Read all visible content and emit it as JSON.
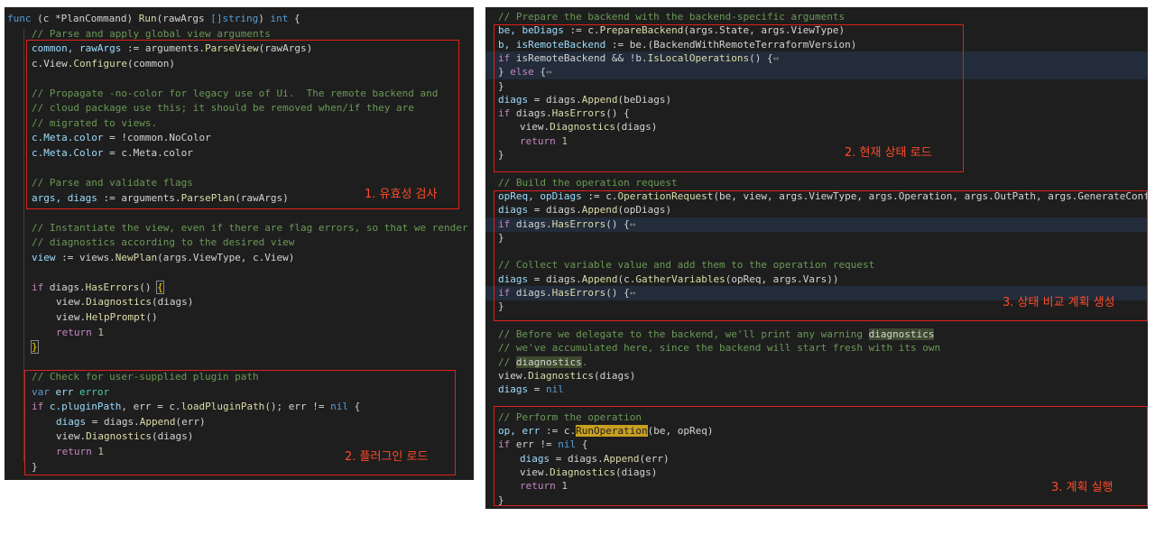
{
  "left_panel": {
    "lines": [
      {
        "hl": false,
        "indent": 0,
        "tokens": [
          {
            "t": "func",
            "c": "keyword"
          },
          {
            "t": " (c ",
            "c": "plain"
          },
          {
            "t": "*PlanCommand",
            "c": "plain"
          },
          {
            "t": ") ",
            "c": "plain"
          },
          {
            "t": "Run",
            "c": "func"
          },
          {
            "t": "(rawArgs ",
            "c": "plain"
          },
          {
            "t": "[]string",
            "c": "keyword"
          },
          {
            "t": ") ",
            "c": "plain"
          },
          {
            "t": "int",
            "c": "keyword"
          },
          {
            "t": " {",
            "c": "plain"
          }
        ]
      },
      {
        "hl": false,
        "indent": 1,
        "tokens": [
          {
            "t": "// Parse and apply global view arguments",
            "c": "comment"
          }
        ]
      },
      {
        "hl": false,
        "indent": 1,
        "tokens": [
          {
            "t": "common, rawArgs",
            "c": "var"
          },
          {
            "t": " := arguments.",
            "c": "plain"
          },
          {
            "t": "ParseView",
            "c": "func"
          },
          {
            "t": "(rawArgs)",
            "c": "plain"
          }
        ]
      },
      {
        "hl": false,
        "indent": 1,
        "tokens": [
          {
            "t": "c.View.",
            "c": "plain"
          },
          {
            "t": "Configure",
            "c": "func"
          },
          {
            "t": "(common)",
            "c": "plain"
          }
        ]
      },
      {
        "hl": false,
        "indent": 1,
        "tokens": []
      },
      {
        "hl": false,
        "indent": 1,
        "tokens": [
          {
            "t": "// Propagate -no-color for legacy use of Ui.  The remote backend and",
            "c": "comment"
          }
        ]
      },
      {
        "hl": false,
        "indent": 1,
        "tokens": [
          {
            "t": "// cloud package use this; it should be removed when/if they are",
            "c": "comment"
          }
        ]
      },
      {
        "hl": false,
        "indent": 1,
        "tokens": [
          {
            "t": "// migrated to views.",
            "c": "comment"
          }
        ]
      },
      {
        "hl": false,
        "indent": 1,
        "tokens": [
          {
            "t": "c.Meta.color",
            "c": "var"
          },
          {
            "t": " = !common.NoColor",
            "c": "plain"
          }
        ]
      },
      {
        "hl": false,
        "indent": 1,
        "tokens": [
          {
            "t": "c.Meta.Color",
            "c": "var"
          },
          {
            "t": " = c.Meta.color",
            "c": "plain"
          }
        ]
      },
      {
        "hl": false,
        "indent": 1,
        "tokens": []
      },
      {
        "hl": false,
        "indent": 1,
        "tokens": [
          {
            "t": "// Parse and validate flags",
            "c": "comment"
          }
        ]
      },
      {
        "hl": false,
        "indent": 1,
        "tokens": [
          {
            "t": "args, diags",
            "c": "var"
          },
          {
            "t": " := arguments.",
            "c": "plain"
          },
          {
            "t": "ParsePlan",
            "c": "func"
          },
          {
            "t": "(rawArgs)",
            "c": "plain"
          }
        ]
      },
      {
        "hl": false,
        "indent": 1,
        "tokens": []
      },
      {
        "hl": false,
        "indent": 1,
        "tokens": [
          {
            "t": "// Instantiate the view, even if there are flag errors, so that we render",
            "c": "comment"
          }
        ]
      },
      {
        "hl": false,
        "indent": 1,
        "tokens": [
          {
            "t": "// diagnostics according to the desired view",
            "c": "comment"
          }
        ]
      },
      {
        "hl": false,
        "indent": 1,
        "tokens": [
          {
            "t": "view",
            "c": "var"
          },
          {
            "t": " := views.",
            "c": "plain"
          },
          {
            "t": "NewPlan",
            "c": "func"
          },
          {
            "t": "(args.ViewType, c.View)",
            "c": "plain"
          }
        ]
      },
      {
        "hl": false,
        "indent": 1,
        "tokens": []
      },
      {
        "hl": false,
        "indent": 1,
        "tokens": [
          {
            "t": "if",
            "c": "control"
          },
          {
            "t": " diags.",
            "c": "plain"
          },
          {
            "t": "HasErrors",
            "c": "func"
          },
          {
            "t": "() ",
            "c": "plain"
          },
          {
            "t": "{",
            "c": "brace"
          }
        ]
      },
      {
        "hl": false,
        "indent": 2,
        "tokens": [
          {
            "t": "view.",
            "c": "plain"
          },
          {
            "t": "Diagnostics",
            "c": "func"
          },
          {
            "t": "(diags)",
            "c": "plain"
          }
        ]
      },
      {
        "hl": false,
        "indent": 2,
        "tokens": [
          {
            "t": "view.",
            "c": "plain"
          },
          {
            "t": "HelpPrompt",
            "c": "func"
          },
          {
            "t": "()",
            "c": "plain"
          }
        ]
      },
      {
        "hl": false,
        "indent": 2,
        "tokens": [
          {
            "t": "return",
            "c": "control"
          },
          {
            "t": " ",
            "c": "plain"
          },
          {
            "t": "1",
            "c": "num"
          }
        ]
      },
      {
        "hl": false,
        "indent": 1,
        "tokens": [
          {
            "t": "}",
            "c": "brace"
          }
        ]
      },
      {
        "hl": false,
        "indent": 1,
        "tokens": []
      },
      {
        "hl": false,
        "indent": 1,
        "tokens": [
          {
            "t": "// Check for user-supplied plugin path",
            "c": "comment"
          }
        ]
      },
      {
        "hl": false,
        "indent": 1,
        "tokens": [
          {
            "t": "var",
            "c": "keyword"
          },
          {
            "t": " err ",
            "c": "var"
          },
          {
            "t": "error",
            "c": "type"
          }
        ]
      },
      {
        "hl": false,
        "indent": 1,
        "tokens": [
          {
            "t": "if",
            "c": "control"
          },
          {
            "t": " ",
            "c": "plain"
          },
          {
            "t": "c.pluginPath",
            "c": "var"
          },
          {
            "t": ", err = c.",
            "c": "plain"
          },
          {
            "t": "loadPluginPath",
            "c": "func"
          },
          {
            "t": "(); err != ",
            "c": "plain"
          },
          {
            "t": "nil",
            "c": "keyword"
          },
          {
            "t": " {",
            "c": "plain"
          }
        ]
      },
      {
        "hl": false,
        "indent": 2,
        "tokens": [
          {
            "t": "diags",
            "c": "var"
          },
          {
            "t": " = diags.",
            "c": "plain"
          },
          {
            "t": "Append",
            "c": "func"
          },
          {
            "t": "(err)",
            "c": "plain"
          }
        ]
      },
      {
        "hl": false,
        "indent": 2,
        "tokens": [
          {
            "t": "view.",
            "c": "plain"
          },
          {
            "t": "Diagnostics",
            "c": "func"
          },
          {
            "t": "(diags)",
            "c": "plain"
          }
        ]
      },
      {
        "hl": false,
        "indent": 2,
        "tokens": [
          {
            "t": "return",
            "c": "control"
          },
          {
            "t": " ",
            "c": "plain"
          },
          {
            "t": "1",
            "c": "num"
          }
        ]
      },
      {
        "hl": false,
        "indent": 1,
        "tokens": [
          {
            "t": "}",
            "c": "plain"
          }
        ]
      }
    ]
  },
  "right_panel": {
    "lines": [
      {
        "hl": false,
        "tokens": [
          {
            "t": "// Prepare the backend with the backend-specific arguments",
            "c": "comment"
          }
        ]
      },
      {
        "hl": false,
        "tokens": [
          {
            "t": "be, beDiags",
            "c": "var"
          },
          {
            "t": " := c.",
            "c": "plain"
          },
          {
            "t": "PrepareBackend",
            "c": "func"
          },
          {
            "t": "(args.State, args.ViewType)",
            "c": "plain"
          }
        ]
      },
      {
        "hl": false,
        "tokens": [
          {
            "t": "b, isRemoteBackend",
            "c": "var"
          },
          {
            "t": " := be.(BackendWithRemoteTerraformVersion)",
            "c": "plain"
          }
        ]
      },
      {
        "hl": true,
        "tokens": [
          {
            "t": "if",
            "c": "control"
          },
          {
            "t": " isRemoteBackend && !b.",
            "c": "plain"
          },
          {
            "t": "IsLocalOperations",
            "c": "func"
          },
          {
            "t": "() {",
            "c": "plain"
          },
          {
            "t": "↔",
            "c": "fold"
          }
        ]
      },
      {
        "hl": true,
        "tokens": [
          {
            "t": "} ",
            "c": "plain"
          },
          {
            "t": "else",
            "c": "control"
          },
          {
            "t": " {",
            "c": "plain"
          },
          {
            "t": "↔",
            "c": "fold"
          }
        ]
      },
      {
        "hl": false,
        "tokens": [
          {
            "t": "}",
            "c": "plain"
          }
        ]
      },
      {
        "hl": false,
        "tokens": [
          {
            "t": "diags",
            "c": "var"
          },
          {
            "t": " = diags.",
            "c": "plain"
          },
          {
            "t": "Append",
            "c": "func"
          },
          {
            "t": "(beDiags)",
            "c": "plain"
          }
        ]
      },
      {
        "hl": false,
        "tokens": [
          {
            "t": "if",
            "c": "control"
          },
          {
            "t": " diags.",
            "c": "plain"
          },
          {
            "t": "HasErrors",
            "c": "func"
          },
          {
            "t": "() {",
            "c": "plain"
          }
        ]
      },
      {
        "hl": false,
        "indent": 1,
        "tokens": [
          {
            "t": "view.",
            "c": "plain"
          },
          {
            "t": "Diagnostics",
            "c": "func"
          },
          {
            "t": "(diags)",
            "c": "plain"
          }
        ]
      },
      {
        "hl": false,
        "indent": 1,
        "tokens": [
          {
            "t": "return",
            "c": "control"
          },
          {
            "t": " ",
            "c": "plain"
          },
          {
            "t": "1",
            "c": "num"
          }
        ]
      },
      {
        "hl": false,
        "tokens": [
          {
            "t": "}",
            "c": "plain"
          }
        ]
      },
      {
        "hl": false,
        "tokens": []
      },
      {
        "hl": false,
        "tokens": [
          {
            "t": "// Build the operation request",
            "c": "comment"
          }
        ]
      },
      {
        "hl": false,
        "tokens": [
          {
            "t": "opReq, opDiags",
            "c": "var"
          },
          {
            "t": " := c.",
            "c": "plain"
          },
          {
            "t": "OperationRequest",
            "c": "func"
          },
          {
            "t": "(be, view, args.ViewType, args.Operation, args.OutPath, args.GenerateConfigPath)",
            "c": "plain"
          }
        ]
      },
      {
        "hl": false,
        "tokens": [
          {
            "t": "diags",
            "c": "var"
          },
          {
            "t": " = diags.",
            "c": "plain"
          },
          {
            "t": "Append",
            "c": "func"
          },
          {
            "t": "(opDiags)",
            "c": "plain"
          }
        ]
      },
      {
        "hl": true,
        "tokens": [
          {
            "t": "if",
            "c": "control"
          },
          {
            "t": " diags.",
            "c": "plain"
          },
          {
            "t": "HasErrors",
            "c": "func"
          },
          {
            "t": "() {",
            "c": "plain"
          },
          {
            "t": "↔",
            "c": "fold"
          }
        ]
      },
      {
        "hl": false,
        "tokens": [
          {
            "t": "}",
            "c": "plain"
          }
        ]
      },
      {
        "hl": false,
        "tokens": []
      },
      {
        "hl": false,
        "tokens": [
          {
            "t": "// Collect variable value and add them to the operation request",
            "c": "comment"
          }
        ]
      },
      {
        "hl": false,
        "tokens": [
          {
            "t": "diags",
            "c": "var"
          },
          {
            "t": " = diags.",
            "c": "plain"
          },
          {
            "t": "Append",
            "c": "func"
          },
          {
            "t": "(c.",
            "c": "plain"
          },
          {
            "t": "GatherVariables",
            "c": "func"
          },
          {
            "t": "(opReq, args.Vars))",
            "c": "plain"
          }
        ]
      },
      {
        "hl": true,
        "tokens": [
          {
            "t": "if",
            "c": "control"
          },
          {
            "t": " diags.",
            "c": "plain"
          },
          {
            "t": "HasErrors",
            "c": "func"
          },
          {
            "t": "() {",
            "c": "plain"
          },
          {
            "t": "↔",
            "c": "fold"
          }
        ]
      },
      {
        "hl": false,
        "tokens": [
          {
            "t": "}",
            "c": "plain"
          }
        ]
      },
      {
        "hl": false,
        "tokens": []
      },
      {
        "hl": false,
        "tokens": [
          {
            "t": "// Before we delegate to the backend, we'll print any warning ",
            "c": "comment"
          },
          {
            "t": "diagnostics",
            "c": "match"
          }
        ]
      },
      {
        "hl": false,
        "tokens": [
          {
            "t": "// we've accumulated here, since the backend will start fresh with its own",
            "c": "comment"
          }
        ]
      },
      {
        "hl": false,
        "tokens": [
          {
            "t": "// ",
            "c": "comment"
          },
          {
            "t": "diagnostics",
            "c": "match"
          },
          {
            "t": ".",
            "c": "comment"
          }
        ]
      },
      {
        "hl": false,
        "tokens": [
          {
            "t": "view.",
            "c": "plain"
          },
          {
            "t": "Diagnostics",
            "c": "func"
          },
          {
            "t": "(diags)",
            "c": "plain"
          }
        ]
      },
      {
        "hl": false,
        "tokens": [
          {
            "t": "diags",
            "c": "var"
          },
          {
            "t": " = ",
            "c": "plain"
          },
          {
            "t": "nil",
            "c": "keyword"
          }
        ]
      },
      {
        "hl": false,
        "tokens": []
      },
      {
        "hl": false,
        "tokens": [
          {
            "t": "// Perform the operation",
            "c": "comment"
          }
        ]
      },
      {
        "hl": false,
        "tokens": [
          {
            "t": "op, err",
            "c": "var"
          },
          {
            "t": " := c.",
            "c": "plain"
          },
          {
            "t": "RunOperation",
            "c": "run"
          },
          {
            "t": "(be, opReq)",
            "c": "plain"
          }
        ]
      },
      {
        "hl": false,
        "tokens": [
          {
            "t": "if",
            "c": "control"
          },
          {
            "t": " err != ",
            "c": "plain"
          },
          {
            "t": "nil",
            "c": "keyword"
          },
          {
            "t": " {",
            "c": "plain"
          }
        ]
      },
      {
        "hl": false,
        "indent": 1,
        "tokens": [
          {
            "t": "diags",
            "c": "var"
          },
          {
            "t": " = diags.",
            "c": "plain"
          },
          {
            "t": "Append",
            "c": "func"
          },
          {
            "t": "(err)",
            "c": "plain"
          }
        ]
      },
      {
        "hl": false,
        "indent": 1,
        "tokens": [
          {
            "t": "view.",
            "c": "plain"
          },
          {
            "t": "Diagnostics",
            "c": "func"
          },
          {
            "t": "(diags)",
            "c": "plain"
          }
        ]
      },
      {
        "hl": false,
        "indent": 1,
        "tokens": [
          {
            "t": "return",
            "c": "control"
          },
          {
            "t": " ",
            "c": "plain"
          },
          {
            "t": "1",
            "c": "num"
          }
        ]
      },
      {
        "hl": false,
        "tokens": [
          {
            "t": "}",
            "c": "plain"
          }
        ]
      }
    ]
  },
  "annotations": {
    "validation": "1. 유효성 검사",
    "plugin_load": "2. 플러그인 로드",
    "state_load": "2. 현재 상태 로드",
    "plan_create": "3. 상태 비교 계획 생성",
    "plan_execute": "3. 계획 실행"
  }
}
